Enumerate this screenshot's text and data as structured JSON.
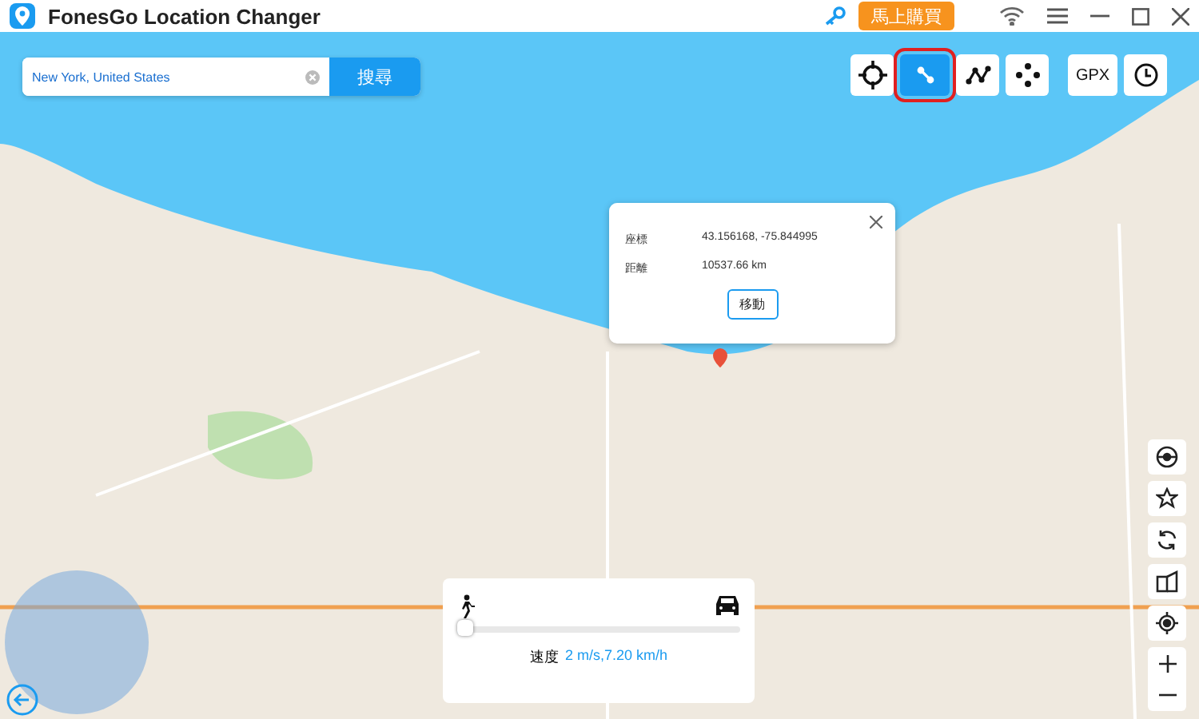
{
  "window": {
    "title": "FonesGo Location Changer",
    "buy_button": "馬上購買"
  },
  "search": {
    "value": "New York, United States",
    "button": "搜尋"
  },
  "tools": [
    {
      "kind": "teleport",
      "selected": false
    },
    {
      "kind": "two-spot",
      "selected": true
    },
    {
      "kind": "multi-spot",
      "selected": false
    },
    {
      "kind": "joystick",
      "selected": false
    },
    {
      "kind": "gpx",
      "label": "GPX",
      "selected": false
    },
    {
      "kind": "history",
      "selected": false
    }
  ],
  "popup": {
    "rows": [
      {
        "label": "座標",
        "value": "43.156168, -75.844995"
      },
      {
        "label": "距離",
        "value": "10537.66 km"
      }
    ],
    "button": "移動"
  },
  "speed": {
    "level": 0.01,
    "label": "速度",
    "value": "2 m/s,7.20 km/h"
  }
}
